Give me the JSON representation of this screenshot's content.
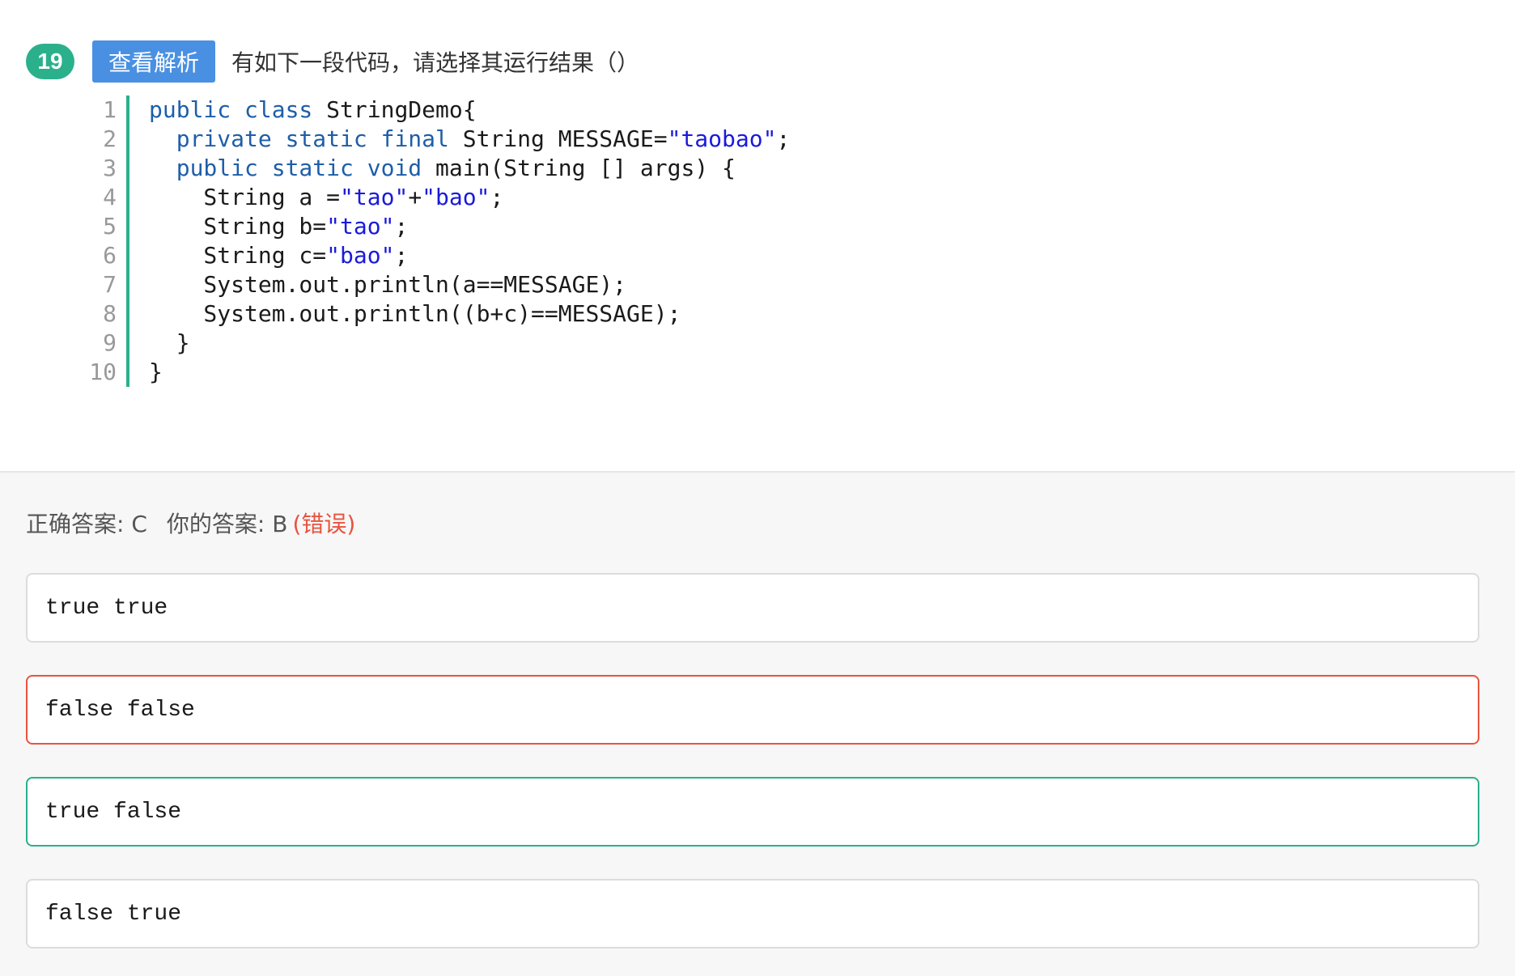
{
  "question": {
    "number": "19",
    "analysis_button": "查看解析",
    "prompt": "有如下一段代码，请选择其运行结果（）"
  },
  "code": {
    "line_numbers": [
      "1",
      "2",
      "3",
      "4",
      "5",
      "6",
      "7",
      "8",
      "9",
      "10"
    ],
    "lines": [
      [
        {
          "t": "public class",
          "c": "kw"
        },
        {
          "t": " StringDemo{",
          "c": ""
        }
      ],
      [
        {
          "t": "  ",
          "c": ""
        },
        {
          "t": "private static final",
          "c": "kw"
        },
        {
          "t": " String MESSAGE=",
          "c": ""
        },
        {
          "t": "\"taobao\"",
          "c": "str"
        },
        {
          "t": ";",
          "c": ""
        }
      ],
      [
        {
          "t": "  ",
          "c": ""
        },
        {
          "t": "public static void",
          "c": "kw"
        },
        {
          "t": " main(String [] args) {",
          "c": ""
        }
      ],
      [
        {
          "t": "    String a =",
          "c": ""
        },
        {
          "t": "\"tao\"",
          "c": "str"
        },
        {
          "t": "+",
          "c": ""
        },
        {
          "t": "\"bao\"",
          "c": "str"
        },
        {
          "t": ";",
          "c": ""
        }
      ],
      [
        {
          "t": "    String b=",
          "c": ""
        },
        {
          "t": "\"tao\"",
          "c": "str"
        },
        {
          "t": ";",
          "c": ""
        }
      ],
      [
        {
          "t": "    String c=",
          "c": ""
        },
        {
          "t": "\"bao\"",
          "c": "str"
        },
        {
          "t": ";",
          "c": ""
        }
      ],
      [
        {
          "t": "    System.out.println(a==MESSAGE);",
          "c": ""
        }
      ],
      [
        {
          "t": "    System.out.println((b+c)==MESSAGE);",
          "c": ""
        }
      ],
      [
        {
          "t": "  }",
          "c": ""
        }
      ],
      [
        {
          "t": "}",
          "c": ""
        }
      ]
    ],
    "colors": {
      "keyword": "#1e5ea8",
      "string": "#1a1adc",
      "accent_bar": "#2bb08c"
    }
  },
  "result": {
    "correct_label": "正确答案: C",
    "your_label": "你的答案: B",
    "status": "(错误)"
  },
  "options": [
    {
      "label": "true true",
      "state": "normal"
    },
    {
      "label": "false false",
      "state": "wrong"
    },
    {
      "label": "true false",
      "state": "correct"
    },
    {
      "label": "false true",
      "state": "normal"
    }
  ],
  "colors": {
    "correct": "#2bb08c",
    "wrong": "#e8533f",
    "button": "#4a90e2"
  }
}
